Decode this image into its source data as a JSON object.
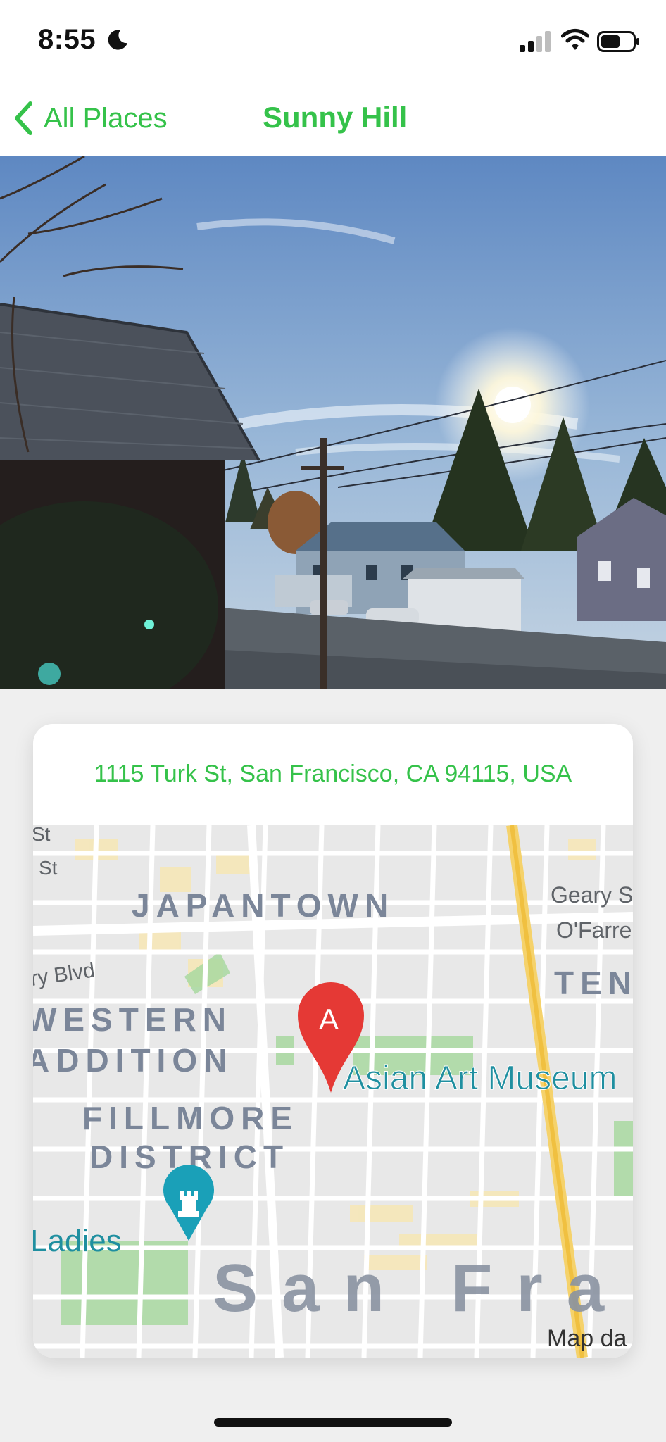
{
  "status": {
    "time": "8:55"
  },
  "nav": {
    "back_label": "All Places",
    "title": "Sunny Hill"
  },
  "place": {
    "address": "1115 Turk St, San Francisco, CA 94115, USA"
  },
  "map": {
    "marker_label": "A",
    "labels": {
      "japantown": "JAPANTOWN",
      "western": "WESTERN",
      "addition": "ADDITION",
      "fillmore": "FILLMORE",
      "district": "DISTRICT",
      "asian_art": "Asian Art Museum",
      "ladies": "Ladies",
      "san_fra": "San Fra",
      "ten": "TEN",
      "geary": "Geary S",
      "ofarrell": "O'Farre",
      "blvd": "ry Blvd",
      "st_1": "St",
      "st_2": "St",
      "map_data": "Map da"
    }
  },
  "colors": {
    "accent": "#35c24a",
    "marker": "#e53935",
    "museum_label": "#1f8fa0"
  }
}
